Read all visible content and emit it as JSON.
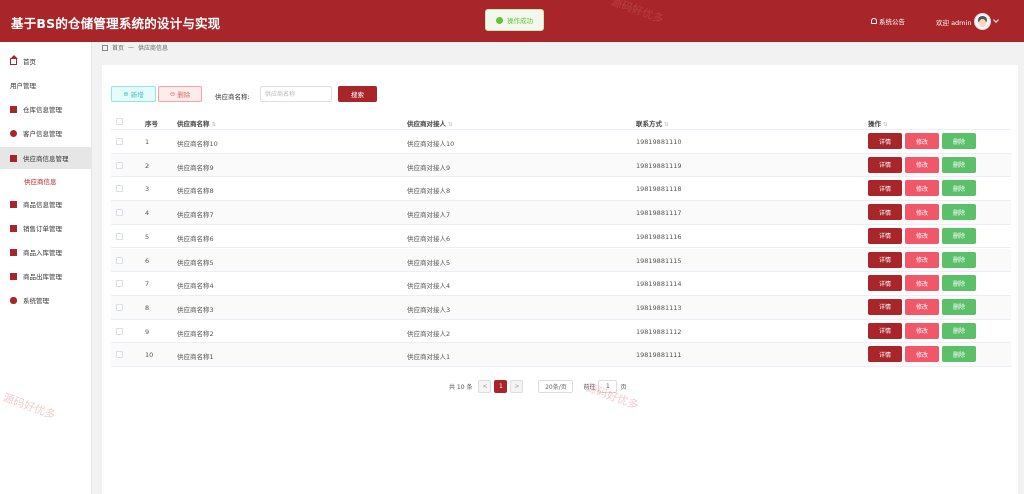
{
  "header": {
    "title": "基于BS的仓储管理系统的设计与实现",
    "toast": "操作成功",
    "notice": "系统公告",
    "user": "欢迎 admin"
  },
  "breadcrumb": {
    "home": "首页",
    "sep": "—",
    "current": "供应商信息"
  },
  "sidebar": {
    "items": [
      {
        "label": "首页",
        "icon": "home-icon"
      },
      {
        "label": "用户管理",
        "icon": "user-icon"
      },
      {
        "label": "仓库信息管理",
        "icon": "warehouse-icon"
      },
      {
        "label": "客户信息管理",
        "icon": "customer-icon"
      },
      {
        "label": "供应商信息管理",
        "icon": "supplier-icon"
      },
      {
        "label": "商品信息管理",
        "icon": "goods-icon"
      },
      {
        "label": "销售订单管理",
        "icon": "order-icon"
      },
      {
        "label": "商品入库管理",
        "icon": "inbound-icon"
      },
      {
        "label": "商品出库管理",
        "icon": "outbound-icon"
      },
      {
        "label": "系统管理",
        "icon": "system-icon"
      }
    ],
    "sub_item": "供应商信息"
  },
  "toolbar": {
    "add": "新增",
    "delete": "删除",
    "search_label": "供应商名称:",
    "search_placeholder": "供应商名称",
    "search_button": "搜索"
  },
  "table": {
    "headers": {
      "index": "序号",
      "name": "供应商名称",
      "contact": "供应商对接人",
      "phone": "联系方式",
      "actions": "操作"
    },
    "rows": [
      {
        "index": "1",
        "name": "供应商名称10",
        "contact": "供应商对接人10",
        "phone": "19819881110"
      },
      {
        "index": "2",
        "name": "供应商名称9",
        "contact": "供应商对接人9",
        "phone": "19819881119"
      },
      {
        "index": "3",
        "name": "供应商名称8",
        "contact": "供应商对接人8",
        "phone": "19819881118"
      },
      {
        "index": "4",
        "name": "供应商名称7",
        "contact": "供应商对接人7",
        "phone": "19819881117"
      },
      {
        "index": "5",
        "name": "供应商名称6",
        "contact": "供应商对接人6",
        "phone": "19819881116"
      },
      {
        "index": "6",
        "name": "供应商名称5",
        "contact": "供应商对接人5",
        "phone": "19819881115"
      },
      {
        "index": "7",
        "name": "供应商名称4",
        "contact": "供应商对接人4",
        "phone": "19819881114"
      },
      {
        "index": "8",
        "name": "供应商名称3",
        "contact": "供应商对接人3",
        "phone": "19819881113"
      },
      {
        "index": "9",
        "name": "供应商名称2",
        "contact": "供应商对接人2",
        "phone": "19819881112"
      },
      {
        "index": "10",
        "name": "供应商名称1",
        "contact": "供应商对接人1",
        "phone": "19819881111"
      }
    ],
    "action_labels": {
      "detail": "详情",
      "edit": "修改",
      "remove": "删除"
    }
  },
  "pagination": {
    "total": "共 10 条",
    "prev": "<",
    "current": "1",
    "next": ">",
    "page_size": "20条/页",
    "goto_label": "前往",
    "goto_value": "1",
    "page_suffix": "页"
  },
  "watermark": "源码好优多",
  "colors": {
    "primary": "#a8262a",
    "edit": "#f05769",
    "remove": "#5cbf6a",
    "add": "#39c7c7"
  }
}
